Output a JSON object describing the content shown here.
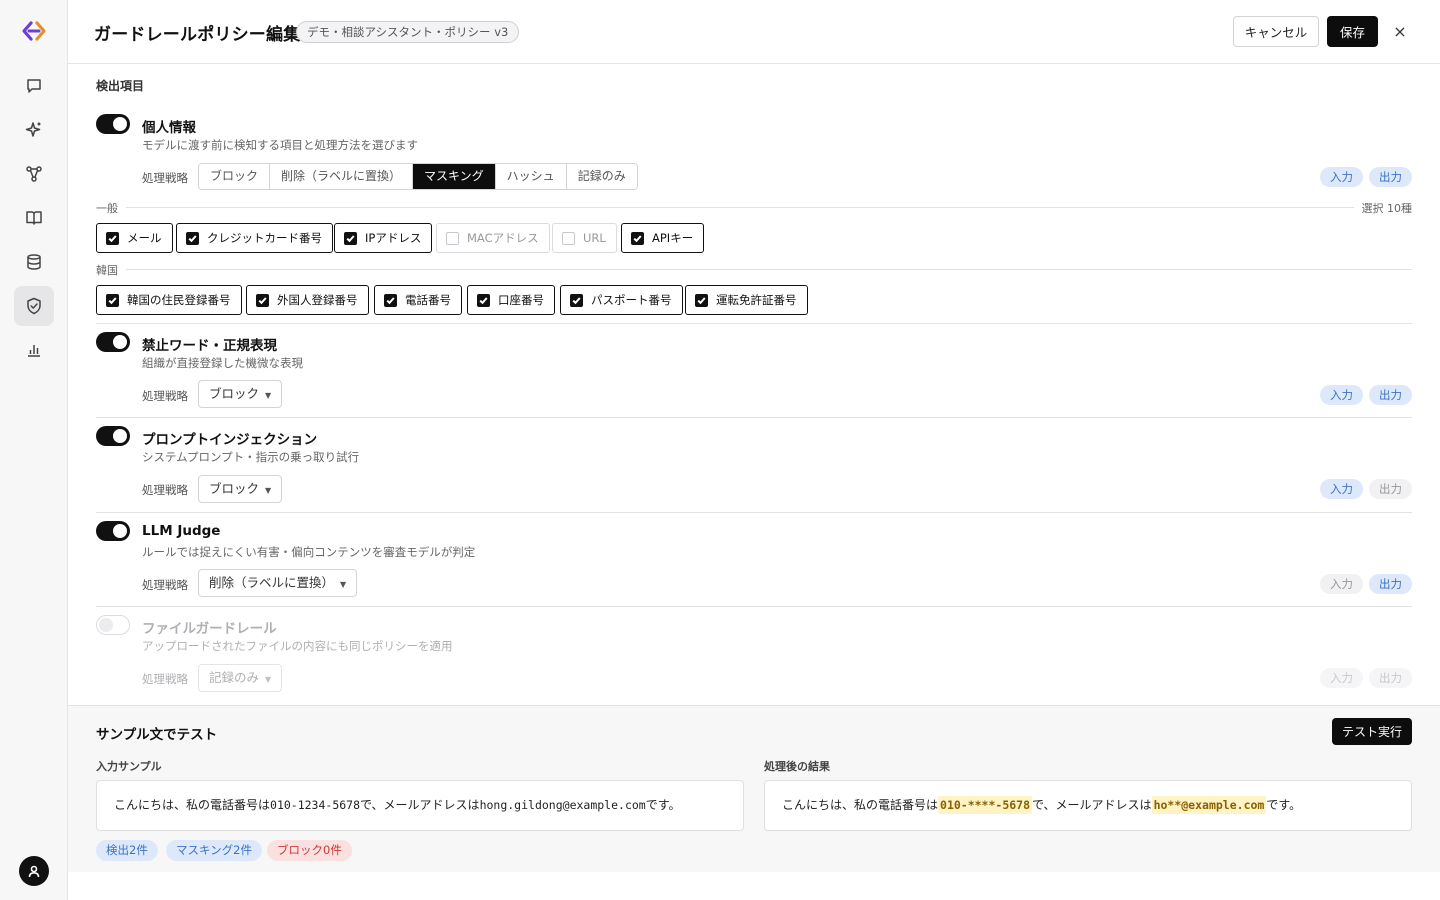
{
  "header": {
    "title": "ガードレールポリシー編集",
    "policy_badge": "デモ・相談アシスタント・ポリシー v3",
    "cancel_label": "キャンセル",
    "save_label": "保存",
    "close_label": "×"
  },
  "sidebar": {
    "items": [
      {
        "name": "chat",
        "icon": "chat-icon"
      },
      {
        "name": "sparkle",
        "icon": "sparkle-icon"
      },
      {
        "name": "workflow",
        "icon": "workflow-icon"
      },
      {
        "name": "knowledge",
        "icon": "book-icon"
      },
      {
        "name": "database",
        "icon": "database-icon"
      },
      {
        "name": "guardrail",
        "icon": "shield-check-icon",
        "active": true
      },
      {
        "name": "analytics",
        "icon": "bar-chart-icon"
      }
    ],
    "avatar_icon": "user-icon"
  },
  "section_label": "検出項目",
  "pii": {
    "title": "個人情報",
    "desc": "モデルに渡す前に検知する項目と処理方法を選びます",
    "strategy_label": "処理戦略",
    "strategy_options": [
      "ブロック",
      "削除（ラベルに置換）",
      "マスキング",
      "ハッシュ",
      "記録のみ"
    ],
    "selected_strategy": "マスキング",
    "input_label": "入力",
    "output_label": "出力",
    "input_on": true,
    "output_on": true,
    "group_general": "一般",
    "selected_count": "選択 10種",
    "general_items": [
      {
        "label": "メール",
        "checked": true
      },
      {
        "label": "クレジットカード番号",
        "checked": true
      },
      {
        "label": "IPアドレス",
        "checked": true
      },
      {
        "label": "MACアドレス",
        "checked": false
      },
      {
        "label": "URL",
        "checked": false
      },
      {
        "label": "APIキー",
        "checked": true
      }
    ],
    "group_korea": "韓国",
    "korea_items": [
      {
        "label": "韓国の住民登録番号",
        "checked": true
      },
      {
        "label": "外国人登録番号",
        "checked": true
      },
      {
        "label": "電話番号",
        "checked": true
      },
      {
        "label": "口座番号",
        "checked": true
      },
      {
        "label": "パスポート番号",
        "checked": true
      },
      {
        "label": "運転免許証番号",
        "checked": true
      }
    ]
  },
  "banned": {
    "title": "禁止ワード・正規表現",
    "desc": "組織が直接登録した機微な表現",
    "strategy_label": "処理戦略",
    "strategy": "ブロック",
    "input_label": "入力",
    "output_label": "出力",
    "input_on": true,
    "output_on": true
  },
  "injection": {
    "title": "プロンプトインジェクション",
    "desc": "システムプロンプト・指示の乗っ取り試行",
    "strategy_label": "処理戦略",
    "strategy": "ブロック",
    "input_label": "入力",
    "output_label": "出力",
    "input_on": true,
    "output_on": false
  },
  "judge": {
    "title": "LLM Judge",
    "desc": "ルールでは捉えにくい有害・偏向コンテンツを審査モデルが判定",
    "strategy_label": "処理戦略",
    "strategy": "削除（ラベルに置換）",
    "input_label": "入力",
    "output_label": "出力",
    "input_on": false,
    "output_on": true
  },
  "file": {
    "title": "ファイルガードレール",
    "desc": "アップロードされたファイルの内容にも同じポリシーを適用",
    "strategy_label": "処理戦略",
    "strategy": "記録のみ",
    "input_label": "入力",
    "output_label": "出力",
    "enabled": false
  },
  "test": {
    "title": "サンプル文でテスト",
    "run_label": "テスト実行",
    "input_label": "入力サンプル",
    "result_label": "処理後の結果",
    "input_prefix": "こんにちは、私の電話番号は",
    "input_phone": "010-1234-5678",
    "input_mid": "で、メールアドレスは",
    "input_email": "hong.gildong@example.com",
    "input_suffix": "です。",
    "result_prefix": "こんにちは、私の電話番号は",
    "result_phone": "010-****-5678",
    "result_mid": "で、メールアドレスは",
    "result_email": "ho**@example.com",
    "result_suffix": "です。",
    "stats": {
      "detected": "検出2件",
      "masked": "マスキング2件",
      "blocked": "ブロック0件"
    }
  }
}
